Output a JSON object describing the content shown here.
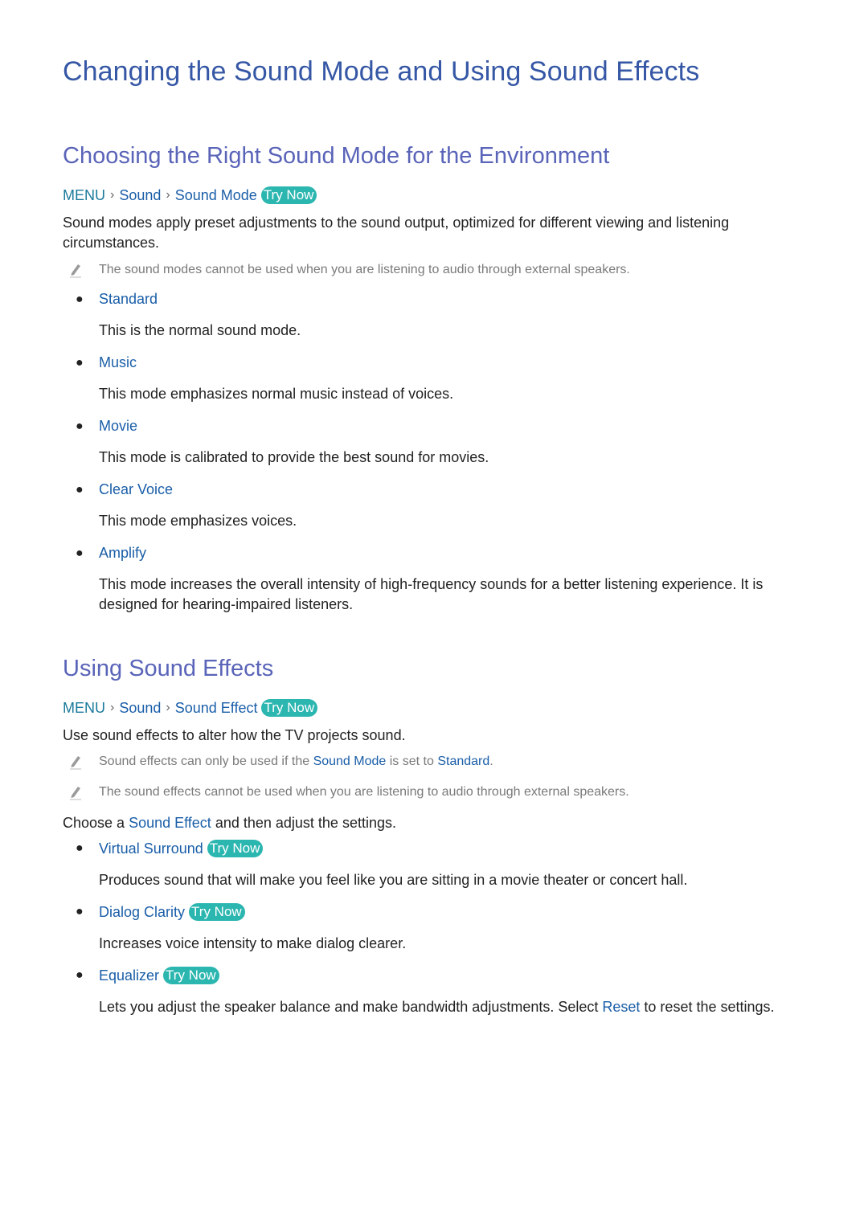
{
  "title": "Changing the Sound Mode and Using Sound Effects",
  "section1": {
    "heading": "Choosing the Right Sound Mode for the Environment",
    "path": {
      "menu": "MENU",
      "item1": "Sound",
      "item2": "Sound Mode",
      "try_now": "Try Now"
    },
    "intro": "Sound modes apply preset adjustments to the sound output, optimized for different viewing and listening circumstances.",
    "note": "The sound modes cannot be used when you are listening to audio through external speakers.",
    "modes": [
      {
        "label": "Standard",
        "desc": "This is the normal sound mode."
      },
      {
        "label": "Music",
        "desc": "This mode emphasizes normal music instead of voices."
      },
      {
        "label": "Movie",
        "desc": "This mode is calibrated to provide the best sound for movies."
      },
      {
        "label": "Clear Voice",
        "desc": "This mode emphasizes voices."
      },
      {
        "label": "Amplify",
        "desc": "This mode increases the overall intensity of high-frequency sounds for a better listening experience. It is designed for hearing-impaired listeners."
      }
    ]
  },
  "section2": {
    "heading": "Using Sound Effects",
    "path": {
      "menu": "MENU",
      "item1": "Sound",
      "item2": "Sound Effect",
      "try_now": "Try Now"
    },
    "intro": "Use sound effects to alter how the TV projects sound.",
    "note1": {
      "pre": "Sound effects can only be used if the ",
      "hl1": "Sound Mode",
      "mid": " is set to ",
      "hl2": "Standard",
      "post": "."
    },
    "note2": "The sound effects cannot be used when you are listening to audio through external speakers.",
    "choose": {
      "pre": "Choose a ",
      "hl": "Sound Effect",
      "post": " and then adjust the settings."
    },
    "effects": [
      {
        "label": "Virtual Surround",
        "try_now": "Try Now",
        "desc": "Produces sound that will make you feel like you are sitting in a movie theater or concert hall."
      },
      {
        "label": "Dialog Clarity",
        "try_now": "Try Now",
        "desc": "Increases voice intensity to make dialog clearer."
      },
      {
        "label": "Equalizer",
        "try_now": "Try Now",
        "desc_pre": "Lets you adjust the speaker balance and make bandwidth adjustments. Select ",
        "desc_hl": "Reset",
        "desc_post": " to reset the settings."
      }
    ]
  },
  "colors": {
    "title": "#3557a5",
    "subheading": "#5a64b8",
    "link": "#1a5ea8",
    "menu": "#1b7a9c",
    "try_now_bg": "#2cb6b0",
    "note_text": "#7a7a7a"
  }
}
